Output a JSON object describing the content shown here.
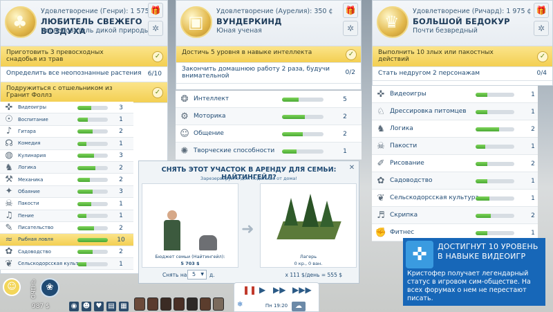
{
  "panels": [
    {
      "satisfaction": "Удовлетворение (Генри): 1 575 ¢",
      "title": "ЛЮБИТЕЛЬ СВЕЖЕГО ВОЗДУХА",
      "subtitle": "Исследователь дикой природы",
      "badge_icon": "tree-badge-icon",
      "goals": [
        {
          "text": "Приготовить 3 превосходных снадобья из трав",
          "done": true
        },
        {
          "text": "Определить все неопознанные растения",
          "count": "6/10",
          "done": false
        },
        {
          "text": "Подружиться с отшельником из Гранит Фоллз",
          "done": true
        }
      ],
      "skills": [
        {
          "name": "Видеоигры",
          "level": "3",
          "fill": 0.45,
          "icon": "gamepad-icon"
        },
        {
          "name": "Воспитание",
          "level": "1",
          "fill": 0.35,
          "icon": "parenting-icon"
        },
        {
          "name": "Гитара",
          "level": "2",
          "fill": 0.5,
          "icon": "guitar-icon"
        },
        {
          "name": "Комедия",
          "level": "1",
          "fill": 0.3,
          "icon": "microphone-icon"
        },
        {
          "name": "Кулинария",
          "level": "3",
          "fill": 0.55,
          "icon": "pan-icon"
        },
        {
          "name": "Логика",
          "level": "2",
          "fill": 0.6,
          "icon": "logic-icon"
        },
        {
          "name": "Механика",
          "level": "2",
          "fill": 0.4,
          "icon": "wrench-icon"
        },
        {
          "name": "Обаяние",
          "level": "3",
          "fill": 0.5,
          "icon": "charisma-icon"
        },
        {
          "name": "Пакости",
          "level": "1",
          "fill": 0.45,
          "icon": "mischief-icon"
        },
        {
          "name": "Пение",
          "level": "1",
          "fill": 0.3,
          "icon": "singing-icon"
        },
        {
          "name": "Писательство",
          "level": "2",
          "fill": 0.55,
          "icon": "quill-icon"
        },
        {
          "name": "Рыбная ловля",
          "level": "10",
          "fill": 1.0,
          "icon": "fish-icon",
          "highlight": true
        },
        {
          "name": "Садоводство",
          "level": "2",
          "fill": 0.5,
          "icon": "garden-icon"
        },
        {
          "name": "Сельскодорсская культура",
          "level": "1",
          "fill": 0.3,
          "icon": "culture-icon"
        }
      ]
    },
    {
      "satisfaction": "Удовлетворение (Аурелия): 350 ¢",
      "title": "ВУНДЕРКИНД",
      "subtitle": "Юная ученая",
      "badge_icon": "blocks-badge-icon",
      "goals": [
        {
          "text": "Достичь 5 уровня в навыке интеллекта",
          "done": true
        },
        {
          "text": "Закончить домашнюю работу 2 раза, будучи внимательной",
          "count": "0/2",
          "done": false
        }
      ],
      "skills": [
        {
          "name": "Интеллект",
          "level": "5",
          "fill": 0.4,
          "icon": "brain-icon"
        },
        {
          "name": "Моторика",
          "level": "2",
          "fill": 0.55,
          "icon": "motor-icon"
        },
        {
          "name": "Общение",
          "level": "2",
          "fill": 0.5,
          "icon": "social-icon"
        },
        {
          "name": "Творческие способности",
          "level": "1",
          "fill": 0.35,
          "icon": "creativity-icon"
        }
      ]
    },
    {
      "satisfaction": "Удовлетворение (Ричард): 1 975 ¢",
      "title": "БОЛЬШОЙ БЕДОКУР",
      "subtitle": "Почти безвредный",
      "badge_icon": "jester-badge-icon",
      "goals": [
        {
          "text": "Выполнить 10 злых или пакостных действий",
          "done": true
        },
        {
          "text": "Стать недругом 2 персонажам",
          "count": "0/4",
          "done": false
        }
      ],
      "skills": [
        {
          "name": "Видеоигры",
          "level": "1",
          "fill": 0.3,
          "icon": "gamepad-icon"
        },
        {
          "name": "Дрессировка питомцев",
          "level": "1",
          "fill": 0.3,
          "icon": "pet-icon"
        },
        {
          "name": "Логика",
          "level": "2",
          "fill": 0.6,
          "icon": "logic-icon"
        },
        {
          "name": "Пакости",
          "level": "1",
          "fill": 0.25,
          "icon": "mischief-icon"
        },
        {
          "name": "Рисование",
          "level": "2",
          "fill": 0.3,
          "icon": "paint-icon"
        },
        {
          "name": "Садоводство",
          "level": "1",
          "fill": 0.3,
          "icon": "garden-icon"
        },
        {
          "name": "Сельскодорсская культура",
          "level": "1",
          "fill": 0.35,
          "icon": "culture-icon"
        },
        {
          "name": "Скрипка",
          "level": "2",
          "fill": 0.4,
          "icon": "violin-icon"
        },
        {
          "name": "Фитнес",
          "level": "1",
          "fill": 0.3,
          "icon": "fitness-icon"
        }
      ]
    }
  ],
  "dialog": {
    "title": "СНЯТЬ ЭТОТ УЧАСТОК В АРЕНДУ ДЛЯ СЕМЬИ: НАЙТИНГЕЙЛ?",
    "subtitle": "Зарезервируйте дом подальше от дома!",
    "family_caption": "Бюджет семьи (Найтингейл):",
    "family_value": "5 703 $",
    "lot_caption": "Лагерь",
    "lot_value": "0 кр., 0 ван.",
    "nights_label": "Снять на",
    "nights_value": "5",
    "nights_unit": "д.",
    "price": "x 111 $/день = 555 $"
  },
  "toast": {
    "title": "ДОСТИГНУТ 10 УРОВЕНЬ В НАВЫКЕ ВИДЕОИГР",
    "body": "Кристофер получает легендарный статус в игровом сим-обществе. На всех форумах о нем не перестают писать.",
    "icon": "gamepad-icon"
  },
  "hud": {
    "money": "987 $",
    "mood": "ОЧЕНЬ",
    "time": "Пн 19:20"
  },
  "colors": {
    "accent": "#1767b8",
    "goal_done": "#f3cf52",
    "skill_bar": "#4aa934"
  }
}
